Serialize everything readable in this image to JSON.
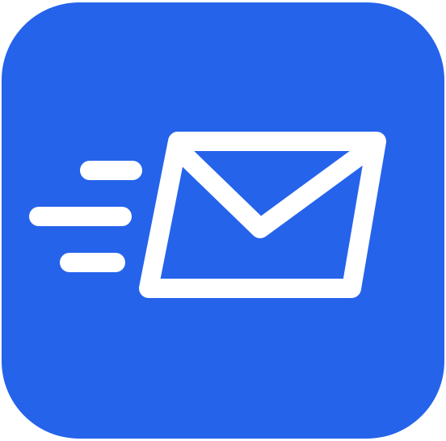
{
  "app_icon": {
    "name": "fast-mail-app-icon",
    "icon": "envelope-with-motion-lines-icon",
    "colors": {
      "background": "#2563eb",
      "foreground": "#ffffff",
      "page_background": "#ffffff"
    }
  }
}
